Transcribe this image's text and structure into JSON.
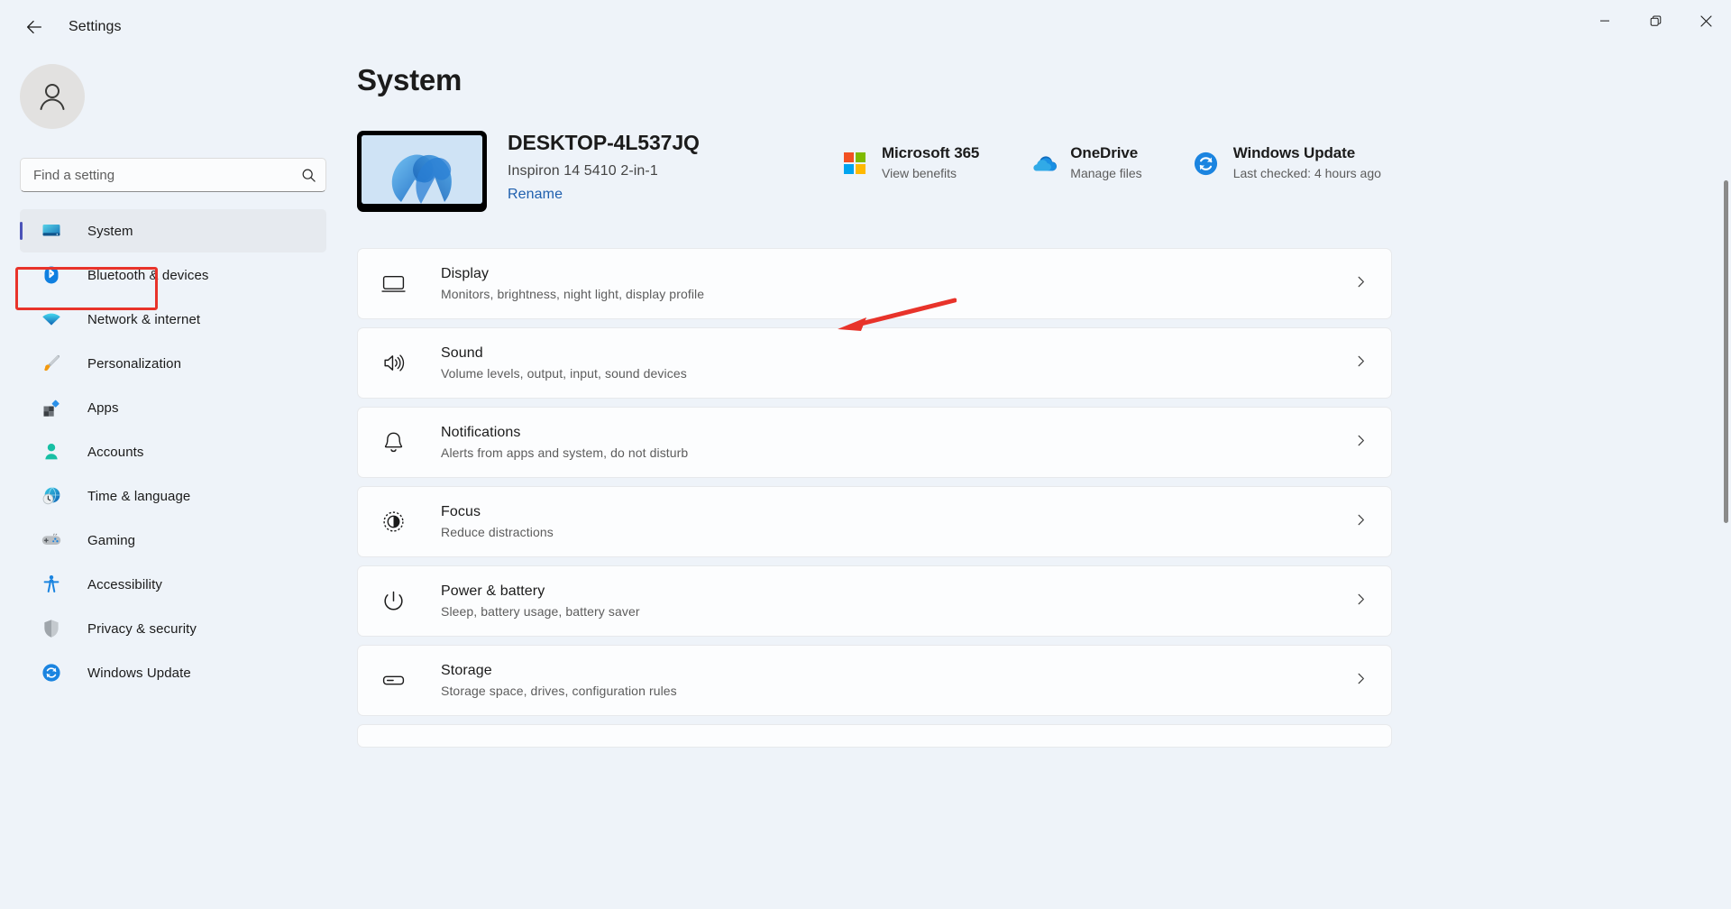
{
  "titlebar": {
    "back_icon": "back-arrow-icon",
    "title": "Settings",
    "minimize_label": "Minimize",
    "maximize_label": "Restore",
    "close_label": "Close"
  },
  "sidebar": {
    "avatar_icon": "user-avatar-icon",
    "search": {
      "placeholder": "Find a setting",
      "icon": "search-icon",
      "value": ""
    },
    "items": [
      {
        "label": "System",
        "icon": "system-monitor-icon",
        "selected": true
      },
      {
        "label": "Bluetooth & devices",
        "icon": "bluetooth-icon",
        "selected": false
      },
      {
        "label": "Network & internet",
        "icon": "wifi-icon",
        "selected": false
      },
      {
        "label": "Personalization",
        "icon": "paintbrush-icon",
        "selected": false
      },
      {
        "label": "Apps",
        "icon": "apps-blocks-icon",
        "selected": false
      },
      {
        "label": "Accounts",
        "icon": "account-person-icon",
        "selected": false
      },
      {
        "label": "Time & language",
        "icon": "clock-globe-icon",
        "selected": false
      },
      {
        "label": "Gaming",
        "icon": "gamepad-icon",
        "selected": false
      },
      {
        "label": "Accessibility",
        "icon": "accessibility-person-icon",
        "selected": false
      },
      {
        "label": "Privacy & security",
        "icon": "shield-icon",
        "selected": false
      },
      {
        "label": "Windows Update",
        "icon": "update-refresh-icon",
        "selected": false
      }
    ]
  },
  "main": {
    "page_title": "System",
    "device": {
      "name": "DESKTOP-4L537JQ",
      "model": "Inspiron 14 5410 2-in-1",
      "rename_label": "Rename",
      "thumbnail_icon": "windows-bloom-wallpaper"
    },
    "quick_links": [
      {
        "title": "Microsoft 365",
        "subtitle": "View benefits",
        "icon": "microsoft-365-icon"
      },
      {
        "title": "OneDrive",
        "subtitle": "Manage files",
        "icon": "onedrive-cloud-icon"
      },
      {
        "title": "Windows Update",
        "subtitle": "Last checked: 4 hours ago",
        "icon": "update-refresh-icon"
      }
    ],
    "rows": [
      {
        "title": "Display",
        "subtitle": "Monitors, brightness, night light, display profile",
        "icon": "display-monitor-icon"
      },
      {
        "title": "Sound",
        "subtitle": "Volume levels, output, input, sound devices",
        "icon": "sound-speaker-icon"
      },
      {
        "title": "Notifications",
        "subtitle": "Alerts from apps and system, do not disturb",
        "icon": "bell-icon"
      },
      {
        "title": "Focus",
        "subtitle": "Reduce distractions",
        "icon": "focus-circle-icon"
      },
      {
        "title": "Power & battery",
        "subtitle": "Sleep, battery usage, battery saver",
        "icon": "power-icon"
      },
      {
        "title": "Storage",
        "subtitle": "Storage space, drives, configuration rules",
        "icon": "storage-drive-icon"
      }
    ]
  },
  "annotations": {
    "highlight_box_target": "System",
    "arrow_target": "Display",
    "color": "#e8332a"
  }
}
